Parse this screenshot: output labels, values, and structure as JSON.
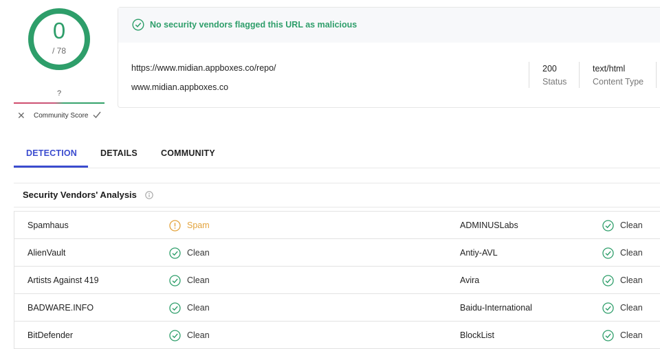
{
  "score": {
    "detections": "0",
    "total": "/ 78",
    "progress": 1.0,
    "color": "#2e9e6a"
  },
  "community": {
    "score": "?",
    "label": "Community Score"
  },
  "banner": {
    "text": "No security vendors flagged this URL as malicious"
  },
  "target": {
    "url": "https://www.midian.appboxes.co/repo/",
    "domain": "www.midian.appboxes.co",
    "status": {
      "value": "200",
      "label": "Status"
    },
    "content_type": {
      "value": "text/html",
      "label": "Content Type"
    }
  },
  "tabs": [
    {
      "label": "DETECTION",
      "active": true
    },
    {
      "label": "DETAILS",
      "active": false
    },
    {
      "label": "COMMUNITY",
      "active": false
    }
  ],
  "section": {
    "title": "Security Vendors' Analysis"
  },
  "vendors": [
    {
      "left": {
        "name": "Spamhaus",
        "result": "Spam",
        "kind": "spam"
      },
      "right": {
        "name": "ADMINUSLabs",
        "result": "Clean",
        "kind": "clean"
      }
    },
    {
      "left": {
        "name": "AlienVault",
        "result": "Clean",
        "kind": "clean"
      },
      "right": {
        "name": "Antiy-AVL",
        "result": "Clean",
        "kind": "clean"
      }
    },
    {
      "left": {
        "name": "Artists Against 419",
        "result": "Clean",
        "kind": "clean"
      },
      "right": {
        "name": "Avira",
        "result": "Clean",
        "kind": "clean"
      }
    },
    {
      "left": {
        "name": "BADWARE.INFO",
        "result": "Clean",
        "kind": "clean"
      },
      "right": {
        "name": "Baidu-International",
        "result": "Clean",
        "kind": "clean"
      }
    },
    {
      "left": {
        "name": "BitDefender",
        "result": "Clean",
        "kind": "clean"
      },
      "right": {
        "name": "BlockList",
        "result": "Clean",
        "kind": "clean"
      }
    }
  ],
  "colors": {
    "clean": "#2e9e6a",
    "spam": "#e3a33c",
    "accent": "#3b4ccf"
  }
}
